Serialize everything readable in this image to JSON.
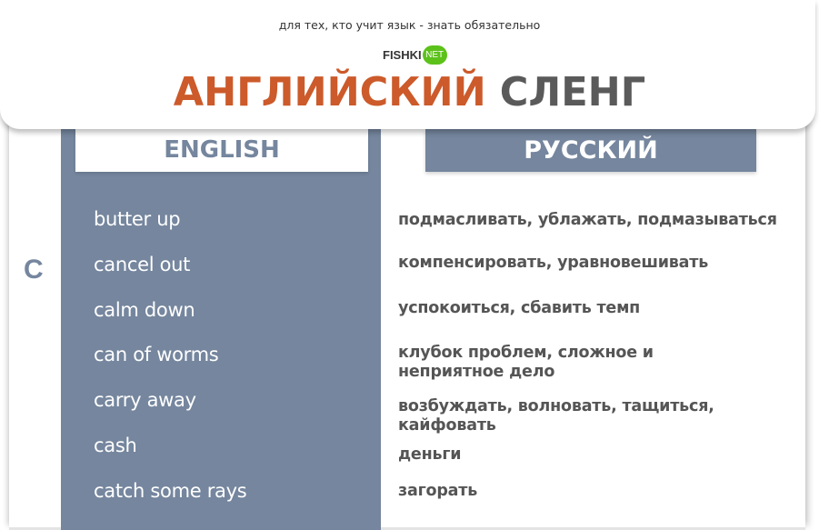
{
  "header": {
    "subtitle": "для тех, кто учит язык - знать обязательно",
    "logo": {
      "main": "FISHKI",
      "badge": "NET",
      "badge_color": "#5cc21a"
    },
    "title_part1": "АНГЛИЙСКИЙ",
    "title_part2": "СЛЕНГ",
    "title_color1": "#cc5a2a",
    "title_color2": "#5a5a5a"
  },
  "columns": {
    "english_label": "ENGLISH",
    "russian_label": "РУССКИЙ",
    "accent_color": "#75869e"
  },
  "letter": "C",
  "entries": [
    {
      "en": "butter up",
      "ru": "подмасливать, ублажать, подмазываться"
    },
    {
      "en": "cancel out",
      "ru": "компенсировать, уравновешивать"
    },
    {
      "en": "calm down",
      "ru": "успокоиться, сбавить темп"
    },
    {
      "en": "can of worms",
      "ru": "клубок проблем, сложное и неприятное дело"
    },
    {
      "en": "carry away",
      "ru": "возбуждать, волновать, тащиться, кайфовать"
    },
    {
      "en": "cash",
      "ru": "деньги"
    },
    {
      "en": "catch some rays",
      "ru": "загорать"
    }
  ]
}
